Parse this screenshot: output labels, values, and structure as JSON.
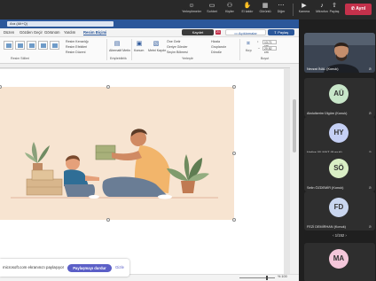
{
  "teams_bar": {
    "buttons": [
      {
        "label": "Yerleştirmeler",
        "icon": "smile-icon"
      },
      {
        "label": "Sohbet",
        "icon": "chat-icon"
      },
      {
        "label": "Kişiler",
        "icon": "people-icon"
      },
      {
        "label": "El kaldır",
        "icon": "hand-icon"
      },
      {
        "label": "Görüntü",
        "icon": "view-icon"
      },
      {
        "label": "Diğer",
        "icon": "more-icon"
      },
      {
        "label": "Kamera",
        "icon": "camera-icon"
      },
      {
        "label": "Mikrofon",
        "icon": "mic-icon"
      },
      {
        "label": "Paylaş",
        "icon": "share-icon"
      }
    ],
    "leave_label": "Ayrıl"
  },
  "word": {
    "search_placeholder": "Ara (Alt+Q)",
    "menu": [
      "Düzen",
      "Gözden Geçir",
      "Görünüm",
      "Yardım",
      "Resim Biçimi"
    ],
    "active_menu": "Resim Biçimi",
    "kaydet_label": "Kaydet",
    "notif_count": "21",
    "comments_label": "Açıklamalar",
    "share_label": "Paylaş",
    "ribbon": {
      "picture_styles_label": "Resim Stilleri",
      "picture_border": "Resim Kenarlığı",
      "picture_effects": "Resim Efektleri",
      "picture_layout": "Resim Düzeni",
      "accessibility_label": "Erişilebilirlik",
      "alt_text": "Alternatif Metin",
      "position": "Konum",
      "wrap_text": "Metni Kaydır",
      "bring_forward": "Öne Getir",
      "send_backward": "Geriye Gönder",
      "selection_pane": "Seçim Bölmesi",
      "align": "Hizala",
      "group": "Gruplandır",
      "rotate": "Döndür",
      "arrange_label": "Yerleştir",
      "crop": "Kırp",
      "height_value": "13,71 cm",
      "width_value": "20,52 cm",
      "size_label": "Boyut"
    },
    "zoom": "% 100"
  },
  "share_bar": {
    "message": "microsoft.com ekranınızı paylaşıyor",
    "stop_label": "Paylaşmayı durdur",
    "hide_label": "Gizle"
  },
  "participants": {
    "tiles": [
      {
        "initials": "AÜ",
        "name": "Abdulkerim Ülgüm (Konuk)",
        "color": "#c8e6c9"
      },
      {
        "initials": "HY",
        "name": "Hatice YILMAZ (Konuk)",
        "color": "#c5d0f5"
      },
      {
        "initials": "SÖ",
        "name": "Selin ÖZDEMİR (Konuk)",
        "color": "#d9eec5"
      },
      {
        "initials": "FD",
        "name": "FEZİ DEMİRHAN (Konuk)",
        "color": "#c9d6ef"
      },
      {
        "initials": "MA",
        "name": "",
        "color": "#f4c7da"
      }
    ],
    "video_name": "Nevzat İNAL (Konuk)",
    "pager": "1/152"
  }
}
